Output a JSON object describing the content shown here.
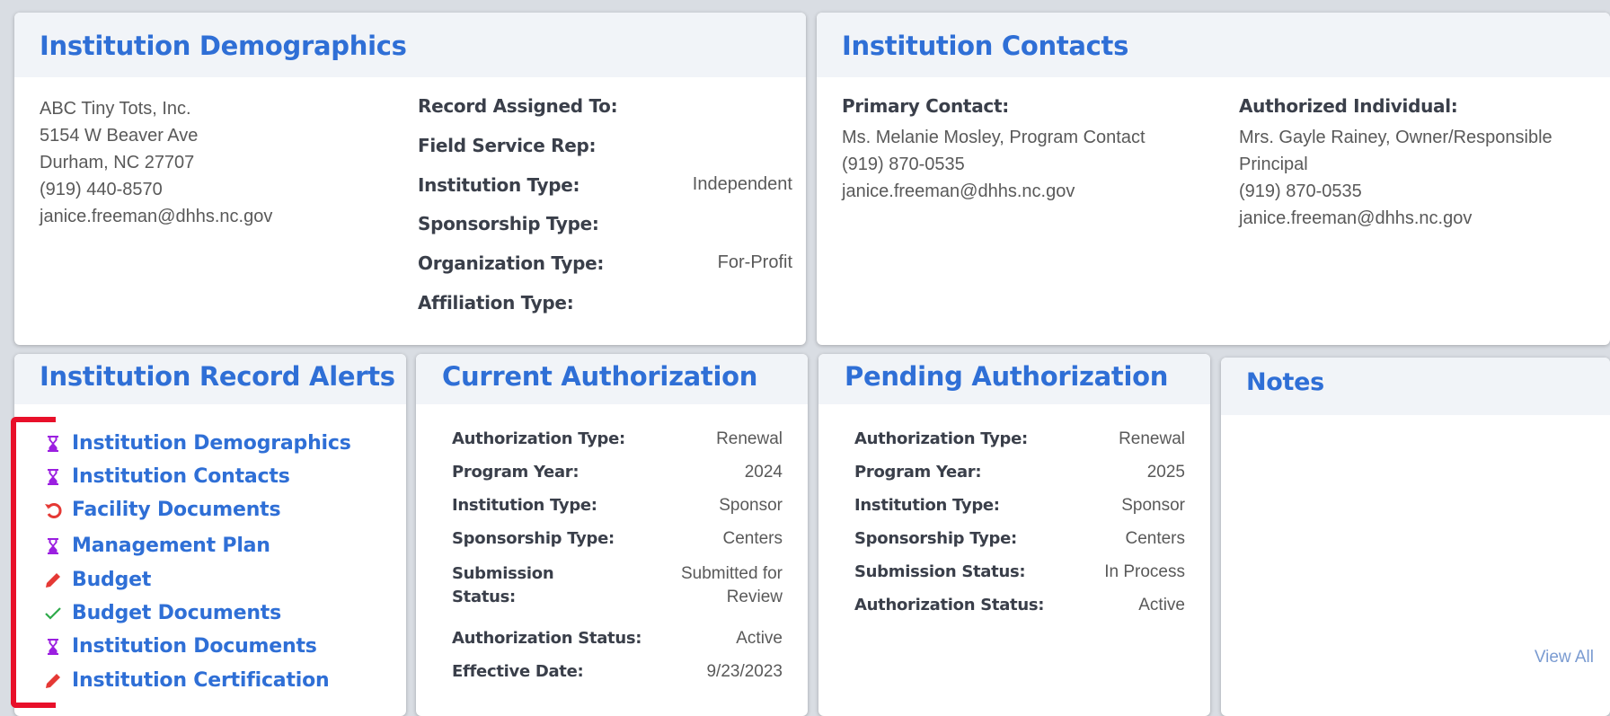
{
  "demographics": {
    "title": "Institution Demographics",
    "address": [
      "ABC Tiny Tots, Inc.",
      "5154 W Beaver Ave",
      "Durham, NC 27707",
      "(919) 440-8570",
      "janice.freeman@dhhs.nc.gov"
    ],
    "fields": [
      {
        "label": "Record Assigned To:",
        "value": ""
      },
      {
        "label": "Field Service Rep:",
        "value": ""
      },
      {
        "label": "Institution Type:",
        "value": "Independent"
      },
      {
        "label": "Sponsorship Type:",
        "value": ""
      },
      {
        "label": "Organization Type:",
        "value": "For-Profit"
      },
      {
        "label": "Affiliation Type:",
        "value": ""
      }
    ]
  },
  "contacts": {
    "title": "Institution Contacts",
    "primary": {
      "label": "Primary Contact:",
      "lines": [
        "Ms. Melanie Mosley, Program Contact",
        "(919) 870-0535",
        "janice.freeman@dhhs.nc.gov"
      ]
    },
    "authorized": {
      "label": "Authorized Individual:",
      "lines": [
        "Mrs. Gayle Rainey, Owner/Responsible",
        "Principal",
        "(919) 870-0535",
        "janice.freeman@dhhs.nc.gov"
      ]
    }
  },
  "alerts": {
    "title": "Institution Record Alerts",
    "items": [
      {
        "label": "Institution Demographics",
        "icon": "hourglass-icon",
        "color": "#9b1fe0"
      },
      {
        "label": "Institution Contacts",
        "icon": "hourglass-icon",
        "color": "#9b1fe0"
      },
      {
        "label": "Facility Documents",
        "icon": "undo-icon",
        "color": "#e53935"
      },
      {
        "label": "Management Plan",
        "icon": "hourglass-icon",
        "color": "#9b1fe0"
      },
      {
        "label": "Budget",
        "icon": "pencil-icon",
        "color": "#e53935"
      },
      {
        "label": "Budget Documents",
        "icon": "check-icon",
        "color": "#2eaa4a"
      },
      {
        "label": "Institution Documents",
        "icon": "hourglass-icon",
        "color": "#9b1fe0"
      },
      {
        "label": "Institution Certification",
        "icon": "pencil-icon",
        "color": "#e53935"
      }
    ],
    "bracket_color": "#e8102a"
  },
  "current": {
    "title": "Current Authorization",
    "rows": [
      {
        "label": "Authorization Type:",
        "value": "Renewal"
      },
      {
        "label": "Program Year:",
        "value": "2024"
      },
      {
        "label": "Institution Type:",
        "value": "Sponsor"
      },
      {
        "label": "Sponsorship Type:",
        "value": "Centers"
      },
      {
        "label": "Submission",
        "label2": "Status:",
        "value": "Submitted for",
        "value2": "Review"
      },
      {
        "label": "Authorization Status:",
        "value": "Active"
      },
      {
        "label": "Effective Date:",
        "value": "9/23/2023"
      }
    ]
  },
  "pending": {
    "title": "Pending Authorization",
    "rows": [
      {
        "label": "Authorization Type:",
        "value": "Renewal"
      },
      {
        "label": "Program Year:",
        "value": "2025"
      },
      {
        "label": "Institution Type:",
        "value": "Sponsor"
      },
      {
        "label": "Sponsorship Type:",
        "value": "Centers"
      },
      {
        "label": "Submission Status:",
        "value": "In Process"
      },
      {
        "label": "Authorization Status:",
        "value": "Active"
      }
    ]
  },
  "notes": {
    "title": "Notes",
    "view_all": "View All"
  },
  "colors": {
    "accent": "#2f6fd6",
    "header_bg": "#f1f4f8"
  }
}
